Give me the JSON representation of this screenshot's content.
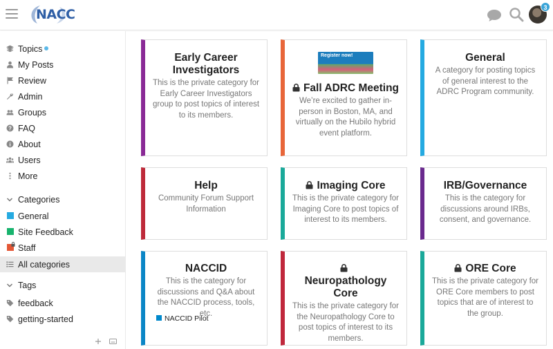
{
  "header": {
    "logo_text": "NACC",
    "notification_count": "3",
    "icons": [
      "hamburger-icon",
      "chat-icon",
      "search-icon"
    ]
  },
  "sidebar": {
    "nav": [
      {
        "label": "Topics",
        "icon": "layers-icon"
      },
      {
        "label": "My Posts",
        "icon": "user-icon"
      },
      {
        "label": "Review",
        "icon": "flag-icon"
      },
      {
        "label": "Admin",
        "icon": "wrench-icon"
      },
      {
        "label": "Groups",
        "icon": "users-icon"
      },
      {
        "label": "FAQ",
        "icon": "question-icon"
      },
      {
        "label": "About",
        "icon": "info-icon"
      },
      {
        "label": "Users",
        "icon": "users-icon"
      },
      {
        "label": "More",
        "icon": "ellipsis-icon"
      }
    ],
    "categories_header": "Categories",
    "categories": [
      {
        "label": "General",
        "color": "#25aae1"
      },
      {
        "label": "Site Feedback",
        "color": "#17b36d"
      },
      {
        "label": "Staff",
        "color": "#e45735"
      },
      {
        "label": "All categories",
        "color": ""
      }
    ],
    "tags_header": "Tags",
    "tags": [
      {
        "label": "feedback"
      },
      {
        "label": "getting-started"
      }
    ]
  },
  "cards": [
    {
      "title": "Early Career Investigators",
      "desc": "This is the private category for Early Career Investigators group to post topics of interest to its members.",
      "color": "#8a2a96",
      "locked": false
    },
    {
      "title": "Fall ADRC Meeting",
      "desc": "We’re excited to gather in-person in Boston, MA, and virtually on the Hubilo hybrid event platform.",
      "color": "#e8663a",
      "locked": true,
      "banner_text": "Register now!"
    },
    {
      "title": "General",
      "desc": "A category for posting topics of general interest to the ADRC Program community.",
      "color": "#25aae1",
      "locked": false
    },
    {
      "title": "Help",
      "desc": "Community Forum Support Information",
      "color": "#be2a3a",
      "locked": false
    },
    {
      "title": "Imaging Core",
      "desc": "This is the private category for Imaging Core to post topics of interest to its members.",
      "color": "#1aa99a",
      "locked": true
    },
    {
      "title": "IRB/Governance",
      "desc": "This is the category for discussions around IRBs, consent, and governance.",
      "color": "#6a2a8e",
      "locked": false
    },
    {
      "title": "NACCID",
      "desc": "This is the category for discussions and Q&A about the NACCID process, tools, etc.",
      "color": "#0b86c6",
      "locked": false,
      "subcategory": "NACCID Pilot"
    },
    {
      "title": "Neuropathology Core",
      "desc": "This is the private category for the Neuropathology Core to post topics of interest to its members.",
      "color": "#c0283c",
      "locked": true
    },
    {
      "title": "ORE Core",
      "desc": "This is the private category for ORE Core members to post topics that are of interest to the group.",
      "color": "#1aa99a",
      "locked": true
    }
  ]
}
